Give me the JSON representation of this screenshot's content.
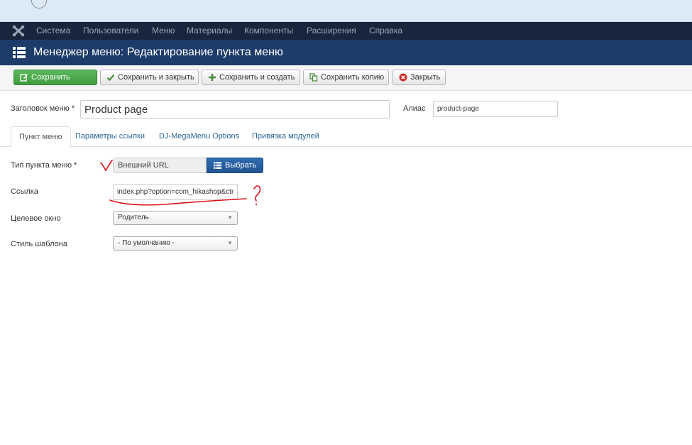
{
  "nav": {
    "items": [
      "Система",
      "Пользователи",
      "Меню",
      "Материалы",
      "Компоненты",
      "Расширения",
      "Справка"
    ]
  },
  "header": {
    "title": "Менеджер меню: Редактирование пункта меню",
    "icon": "list-icon"
  },
  "toolbar": {
    "save": "Сохранить",
    "save_close": "Сохранить и закрыть",
    "save_new": "Сохранить и создать",
    "save_copy": "Сохранить копию",
    "close": "Закрыть"
  },
  "form": {
    "title_label": "Заголовок меню *",
    "title_value": "Product page",
    "alias_label": "Алиас",
    "alias_value": "product-page"
  },
  "tabs": [
    "Пункт меню",
    "Параметры ссылки",
    "DJ-MegaMenu Options",
    "Привязка модулей"
  ],
  "details": {
    "type_label": "Тип пункта меню *",
    "type_value": "Внешний URL",
    "select_button": "Выбрать",
    "link_label": "Ссылка",
    "link_value": "index.php?option=com_hikashop&ctrl=product",
    "target_label": "Целевое окно",
    "target_value": "Родитель",
    "style_label": "Стиль шаблона",
    "style_value": "- По умолчанию -"
  },
  "colors": {
    "navbar": "#17263d",
    "header": "#1e3c6a",
    "save_green": "#46a546",
    "select_blue": "#2a5e9e",
    "annotation_red": "#e0101a"
  }
}
